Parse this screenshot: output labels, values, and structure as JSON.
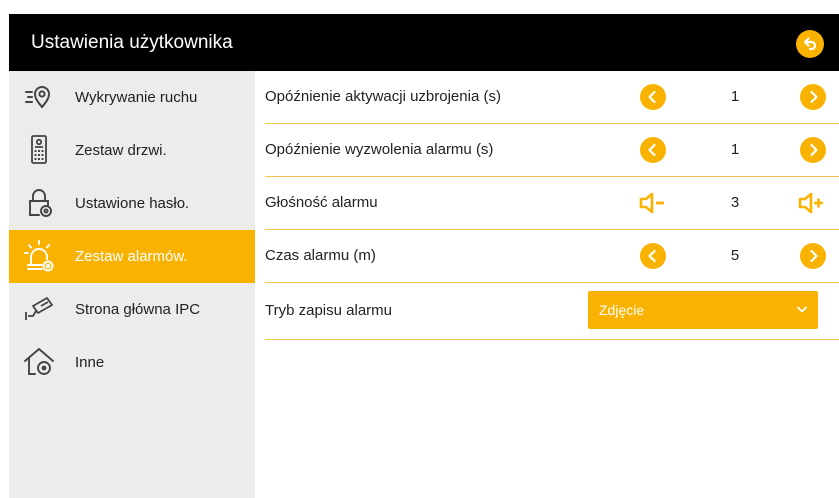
{
  "header": {
    "title": "Ustawienia użytkownika",
    "back_icon": "back-arrow-icon"
  },
  "colors": {
    "accent": "#f9b200",
    "header_bg": "#000000",
    "sidebar_bg": "#ececec",
    "divider": "#f6c452"
  },
  "sidebar": {
    "items": [
      {
        "label": "Wykrywanie ruchu",
        "icon": "motion-detection-icon",
        "active": false
      },
      {
        "label": "Zestaw drzwi.",
        "icon": "door-station-icon",
        "active": false
      },
      {
        "label": "Ustawione hasło.",
        "icon": "password-lock-icon",
        "active": false
      },
      {
        "label": "Zestaw alarmów.",
        "icon": "alarm-settings-icon",
        "active": true
      },
      {
        "label": "Strona główna IPC",
        "icon": "ip-camera-icon",
        "active": false
      },
      {
        "label": "Inne",
        "icon": "home-settings-icon",
        "active": false
      }
    ]
  },
  "settings": {
    "rows": [
      {
        "label": "Opóźnienie aktywacji uzbrojenia (s)",
        "value": "1",
        "control": "arrows"
      },
      {
        "label": "Opóźnienie wyzwolenia alarmu (s)",
        "value": "1",
        "control": "arrows"
      },
      {
        "label": "Głośność alarmu",
        "value": "3",
        "control": "volume"
      },
      {
        "label": "Czas alarmu (m)",
        "value": "5",
        "control": "arrows"
      },
      {
        "label": "Tryb zapisu alarmu",
        "value": "Zdjęcie",
        "control": "dropdown"
      }
    ]
  }
}
